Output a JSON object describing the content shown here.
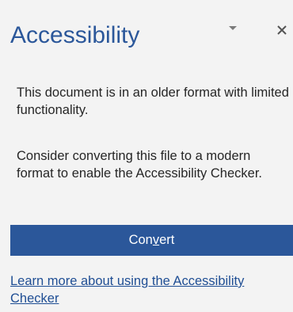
{
  "pane": {
    "title": "Accessibility",
    "icons": {
      "dropdown": "chevron-down-icon",
      "close": "close-icon"
    },
    "message_1": "This document is in an older format with limited functionality.",
    "message_2": "Consider converting this file to a modern format to enable the Accessibility Checker.",
    "convert_button": {
      "label": "Convert",
      "access_key": "v"
    },
    "learn_more_link": "Learn more about using the Accessibility Checker"
  },
  "colors": {
    "accent": "#2b579a",
    "background": "#f3f3f3",
    "text": "#262626",
    "link": "#1f4e94"
  }
}
